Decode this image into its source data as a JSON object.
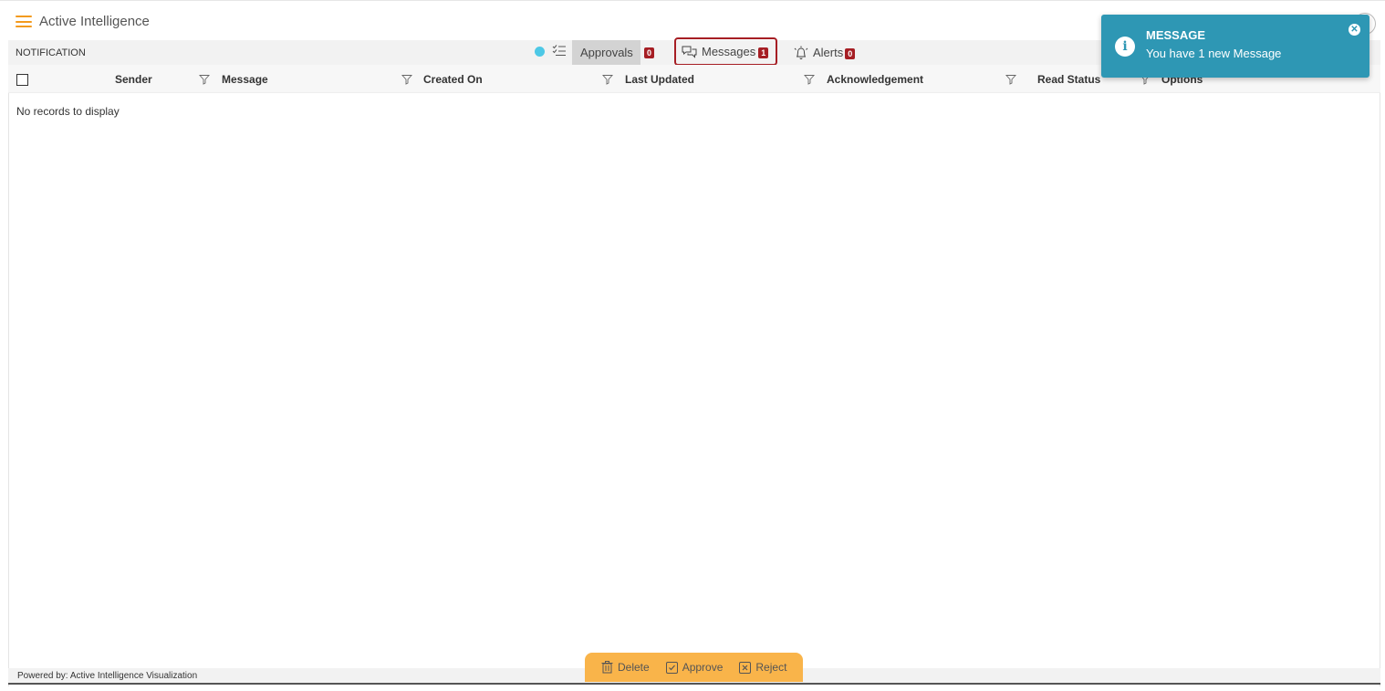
{
  "app": {
    "title": "Active Intelligence"
  },
  "header": {
    "section_label": "NOTIFICATION"
  },
  "tabs": {
    "approvals": {
      "label": "Approvals",
      "count": "0"
    },
    "messages": {
      "label": "Messages",
      "count": "1"
    },
    "alerts": {
      "label": "Alerts",
      "count": "0"
    }
  },
  "table": {
    "columns": [
      "Sender",
      "Message",
      "Created On",
      "Last Updated",
      "Acknowledgement",
      "Read Status",
      "Options"
    ],
    "empty_text": "No records to display"
  },
  "actions": {
    "delete": "Delete",
    "approve": "Approve",
    "reject": "Reject"
  },
  "footer": {
    "powered_by": "Powered by: Active Intelligence Visualization"
  },
  "toast": {
    "title": "MESSAGE",
    "text": "You have 1 new Message"
  },
  "colors": {
    "accent_orange": "#f39a1e",
    "badge_red": "#a61e24",
    "toast_blue": "#2e97b4",
    "dot_cyan": "#4dc8e6",
    "action_bar": "#f9b44a"
  },
  "icons": [
    "hamburger-menu-icon",
    "checklist-icon",
    "chat-bubbles-icon",
    "bell-icon",
    "filter-icon",
    "trash-icon",
    "check-square-icon",
    "x-square-icon",
    "info-icon",
    "close-icon"
  ]
}
